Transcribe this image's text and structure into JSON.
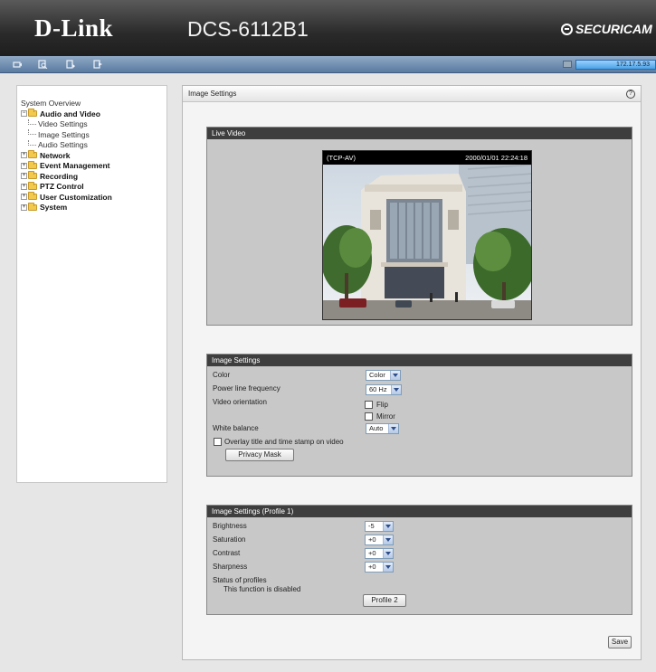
{
  "header": {
    "brand": "D-Link",
    "model": "DCS-6112B1",
    "partner_logo": "SECURICAM"
  },
  "toolbar": {
    "icons": [
      "camera-icon",
      "client-icon",
      "setup-icon",
      "logout-icon"
    ],
    "ip": "172.17.5.93"
  },
  "sidebar": {
    "top_label": "System Overview",
    "groups": [
      {
        "label": "Audio and Video",
        "expanded": true,
        "children": [
          "Video Settings",
          "Image Settings",
          "Audio Settings"
        ]
      },
      {
        "label": "Network"
      },
      {
        "label": "Event Management"
      },
      {
        "label": "Recording"
      },
      {
        "label": "PTZ Control"
      },
      {
        "label": "User Customization"
      },
      {
        "label": "System"
      }
    ]
  },
  "main": {
    "title": "Image Settings",
    "help": "?",
    "live": {
      "title": "Live Video",
      "stream": "(TCP-AV)",
      "timestamp": "2000/01/01 22:24:18"
    },
    "image_settings": {
      "title": "Image Settings",
      "color_label": "Color",
      "color_value": "Color",
      "power_label": "Power line frequency",
      "power_value": "60 Hz",
      "orientation_label": "Video orientation",
      "flip_label": "Flip",
      "mirror_label": "Mirror",
      "wb_label": "White balance",
      "wb_value": "Auto",
      "overlay_label": "Overlay title and time stamp on video",
      "privacy_button": "Privacy Mask"
    },
    "profile": {
      "title": "Image Settings (Profile 1)",
      "brightness_label": "Brightness",
      "brightness_value": "-5",
      "saturation_label": "Saturation",
      "saturation_value": "+0",
      "contrast_label": "Contrast",
      "contrast_value": "+0",
      "sharpness_label": "Sharpness",
      "sharpness_value": "+0",
      "status_label": "Status of profiles",
      "status_value": "This function is disabled",
      "profile_button": "Profile 2"
    },
    "save_button": "Save"
  },
  "colors": {
    "header_dark": "#2a2a2a",
    "toolbar_blue": "#6d8bb0",
    "panel_title": "#3e3e3e",
    "panel_bg": "#c8c8c8",
    "folder": "#f2c94c"
  }
}
